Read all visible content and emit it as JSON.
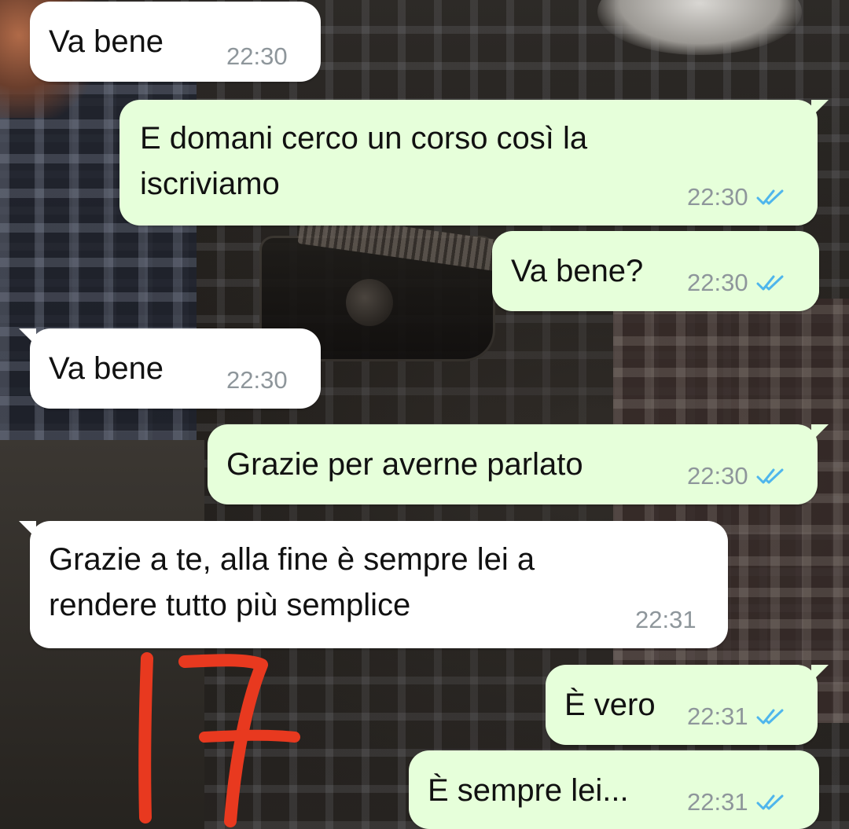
{
  "messages": [
    {
      "direction": "incoming",
      "text": "Va bene",
      "time": "22:30"
    },
    {
      "direction": "outgoing",
      "text_lines": [
        "E domani cerco un corso così la",
        "iscriviamo"
      ],
      "time": "22:30",
      "status": "read-ticks-icon"
    },
    {
      "direction": "outgoing",
      "text": "Va bene?",
      "time": "22:30",
      "status": "read-ticks-icon"
    },
    {
      "direction": "incoming",
      "text": "Va bene",
      "time": "22:30"
    },
    {
      "direction": "outgoing",
      "text": "Grazie per averne parlato",
      "time": "22:30",
      "status": "read-ticks-icon"
    },
    {
      "direction": "incoming",
      "text_lines": [
        "Grazie a te, alla fine è sempre lei a",
        "rendere tutto più semplice"
      ],
      "time": "22:31"
    },
    {
      "direction": "outgoing",
      "text": "È vero",
      "time": "22:31",
      "status": "read-ticks-icon"
    },
    {
      "direction": "outgoing",
      "text": "È sempre lei...",
      "time": "22:31",
      "status": "read-ticks-icon"
    }
  ],
  "annotation": {
    "text": "17",
    "color": "#e8391f"
  },
  "colors": {
    "incoming_bubble": "#ffffff",
    "outgoing_bubble": "#e6ffda",
    "timestamp": "#8e969b",
    "read_ticks": "#4fb6ec"
  }
}
